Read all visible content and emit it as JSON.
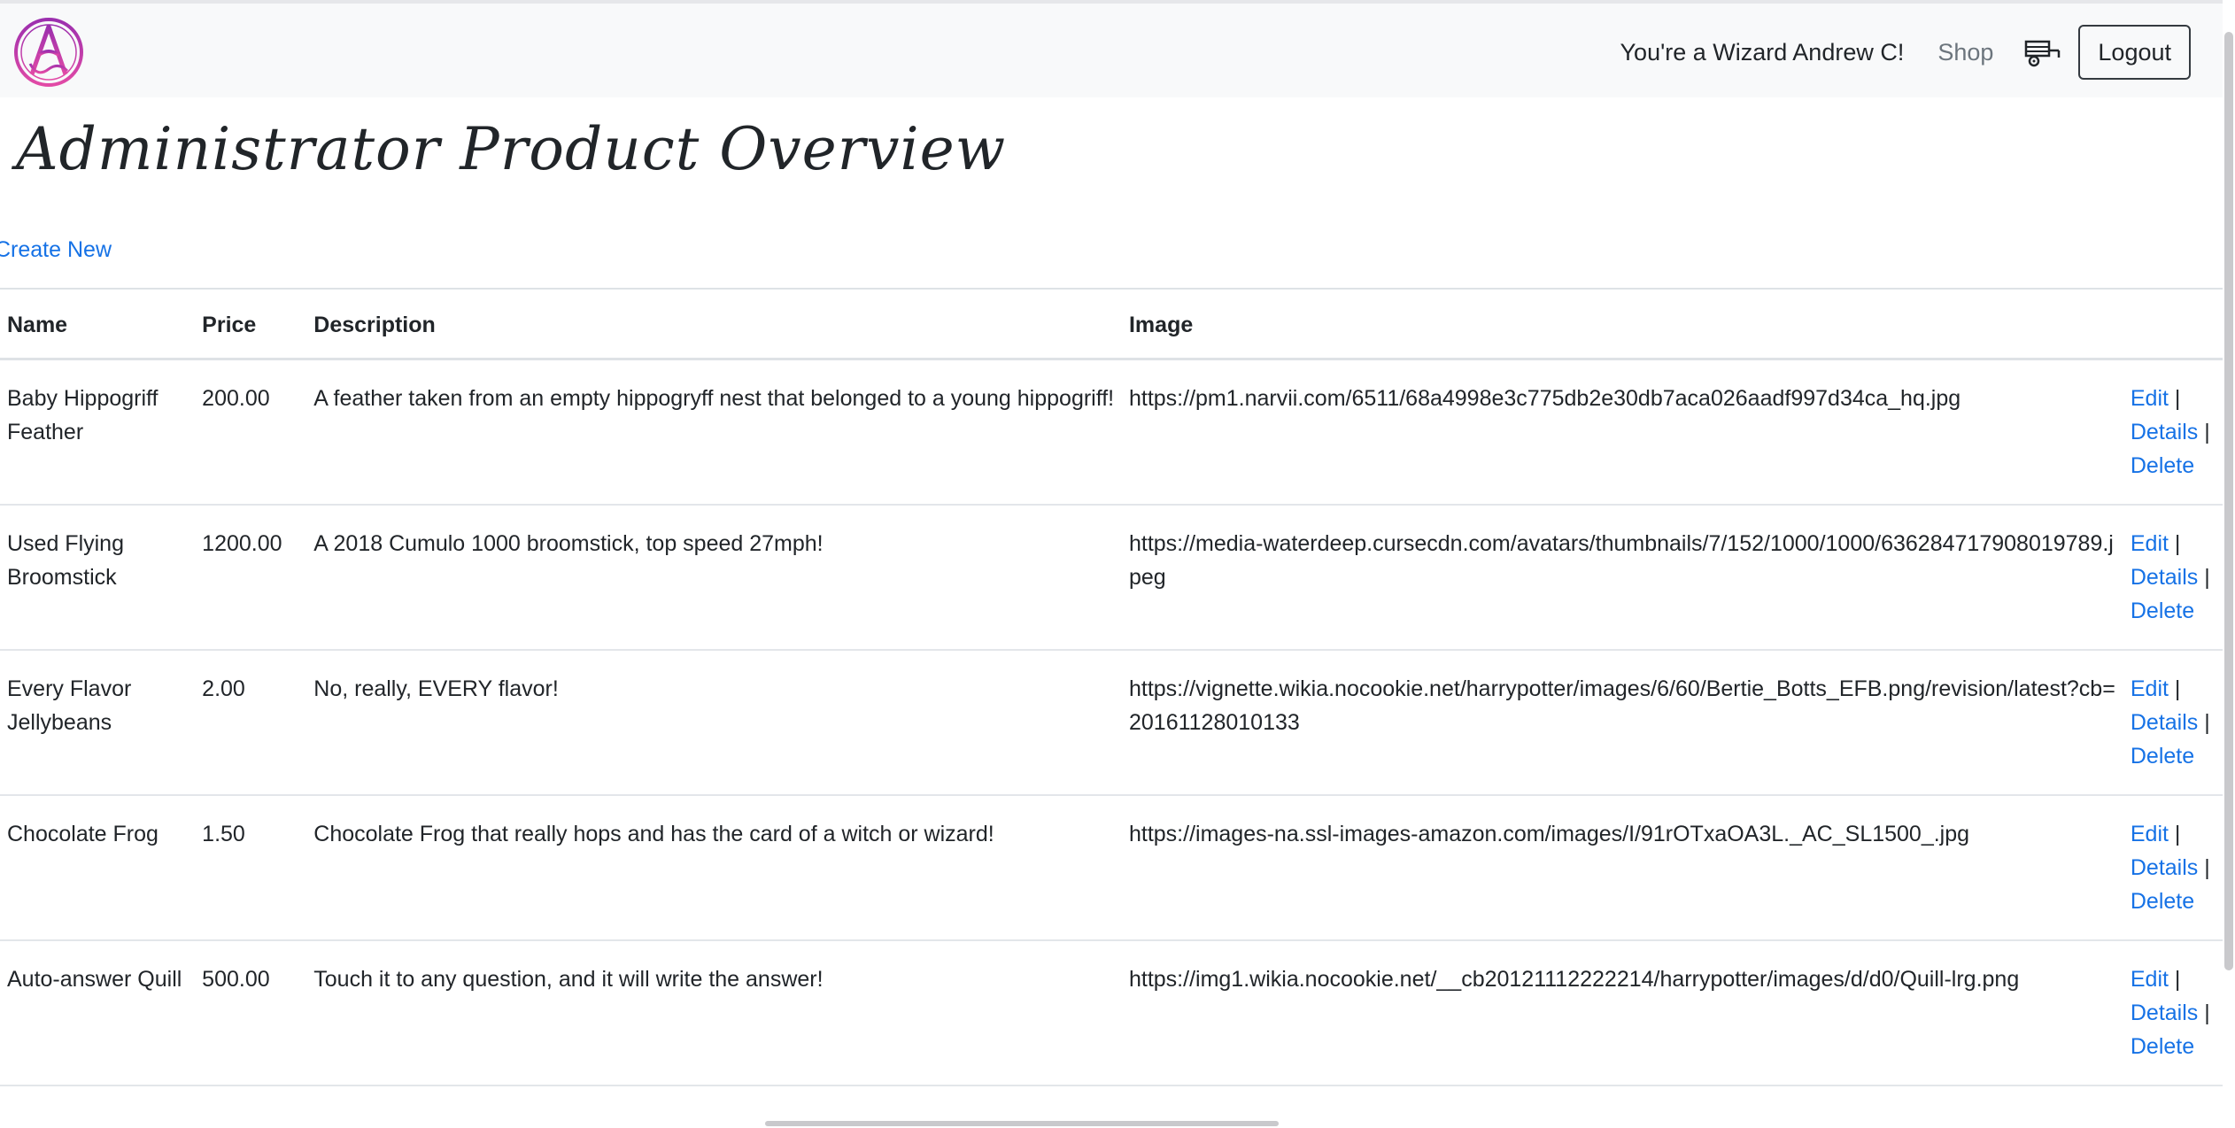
{
  "navbar": {
    "greeting": "You're a Wizard Andrew C!",
    "shop_label": "Shop",
    "cart_icon": "cart-icon",
    "logout_label": "Logout",
    "logo_icon": "wizard-a-logo"
  },
  "page": {
    "title": "Administrator Product Overview",
    "create_label": "Create New"
  },
  "table": {
    "headers": [
      "Name",
      "Price",
      "Description",
      "Image"
    ],
    "actions": {
      "edit": "Edit",
      "details": "Details",
      "delete": "Delete",
      "separator": "|"
    },
    "rows": [
      {
        "name": "Baby Hippogriff Feather",
        "price": "200.00",
        "description": "A feather taken from an empty hippogryff nest that belonged to a young hippogriff!",
        "image": "https://pm1.narvii.com/6511/68a4998e3c775db2e30db7aca026aadf997d34ca_hq.jpg"
      },
      {
        "name": "Used Flying Broomstick",
        "price": "1200.00",
        "description": "A 2018 Cumulo 1000 broomstick, top speed 27mph!",
        "image": "https://media-waterdeep.cursecdn.com/avatars/thumbnails/7/152/1000/1000/636284717908019789.jpeg"
      },
      {
        "name": "Every Flavor Jellybeans",
        "price": "2.00",
        "description": "No, really, EVERY flavor!",
        "image": "https://vignette.wikia.nocookie.net/harrypotter/images/6/60/Bertie_Botts_EFB.png/revision/latest?cb=20161128010133"
      },
      {
        "name": "Chocolate Frog",
        "price": "1.50",
        "description": "Chocolate Frog that really hops and has the card of a witch or wizard!",
        "image": "https://images-na.ssl-images-amazon.com/images/I/91rOTxaOA3L._AC_SL1500_.jpg"
      },
      {
        "name": "Auto-answer Quill",
        "price": "500.00",
        "description": "Touch it to any question, and it will write the answer!",
        "image": "https://img1.wikia.nocookie.net/__cb20121112222214/harrypotter/images/d/d0/Quill-lrg.png"
      }
    ]
  },
  "colors": {
    "link": "#1672e6",
    "navbar_bg": "#f8f9fa",
    "logo_pink": "#c2389e"
  }
}
